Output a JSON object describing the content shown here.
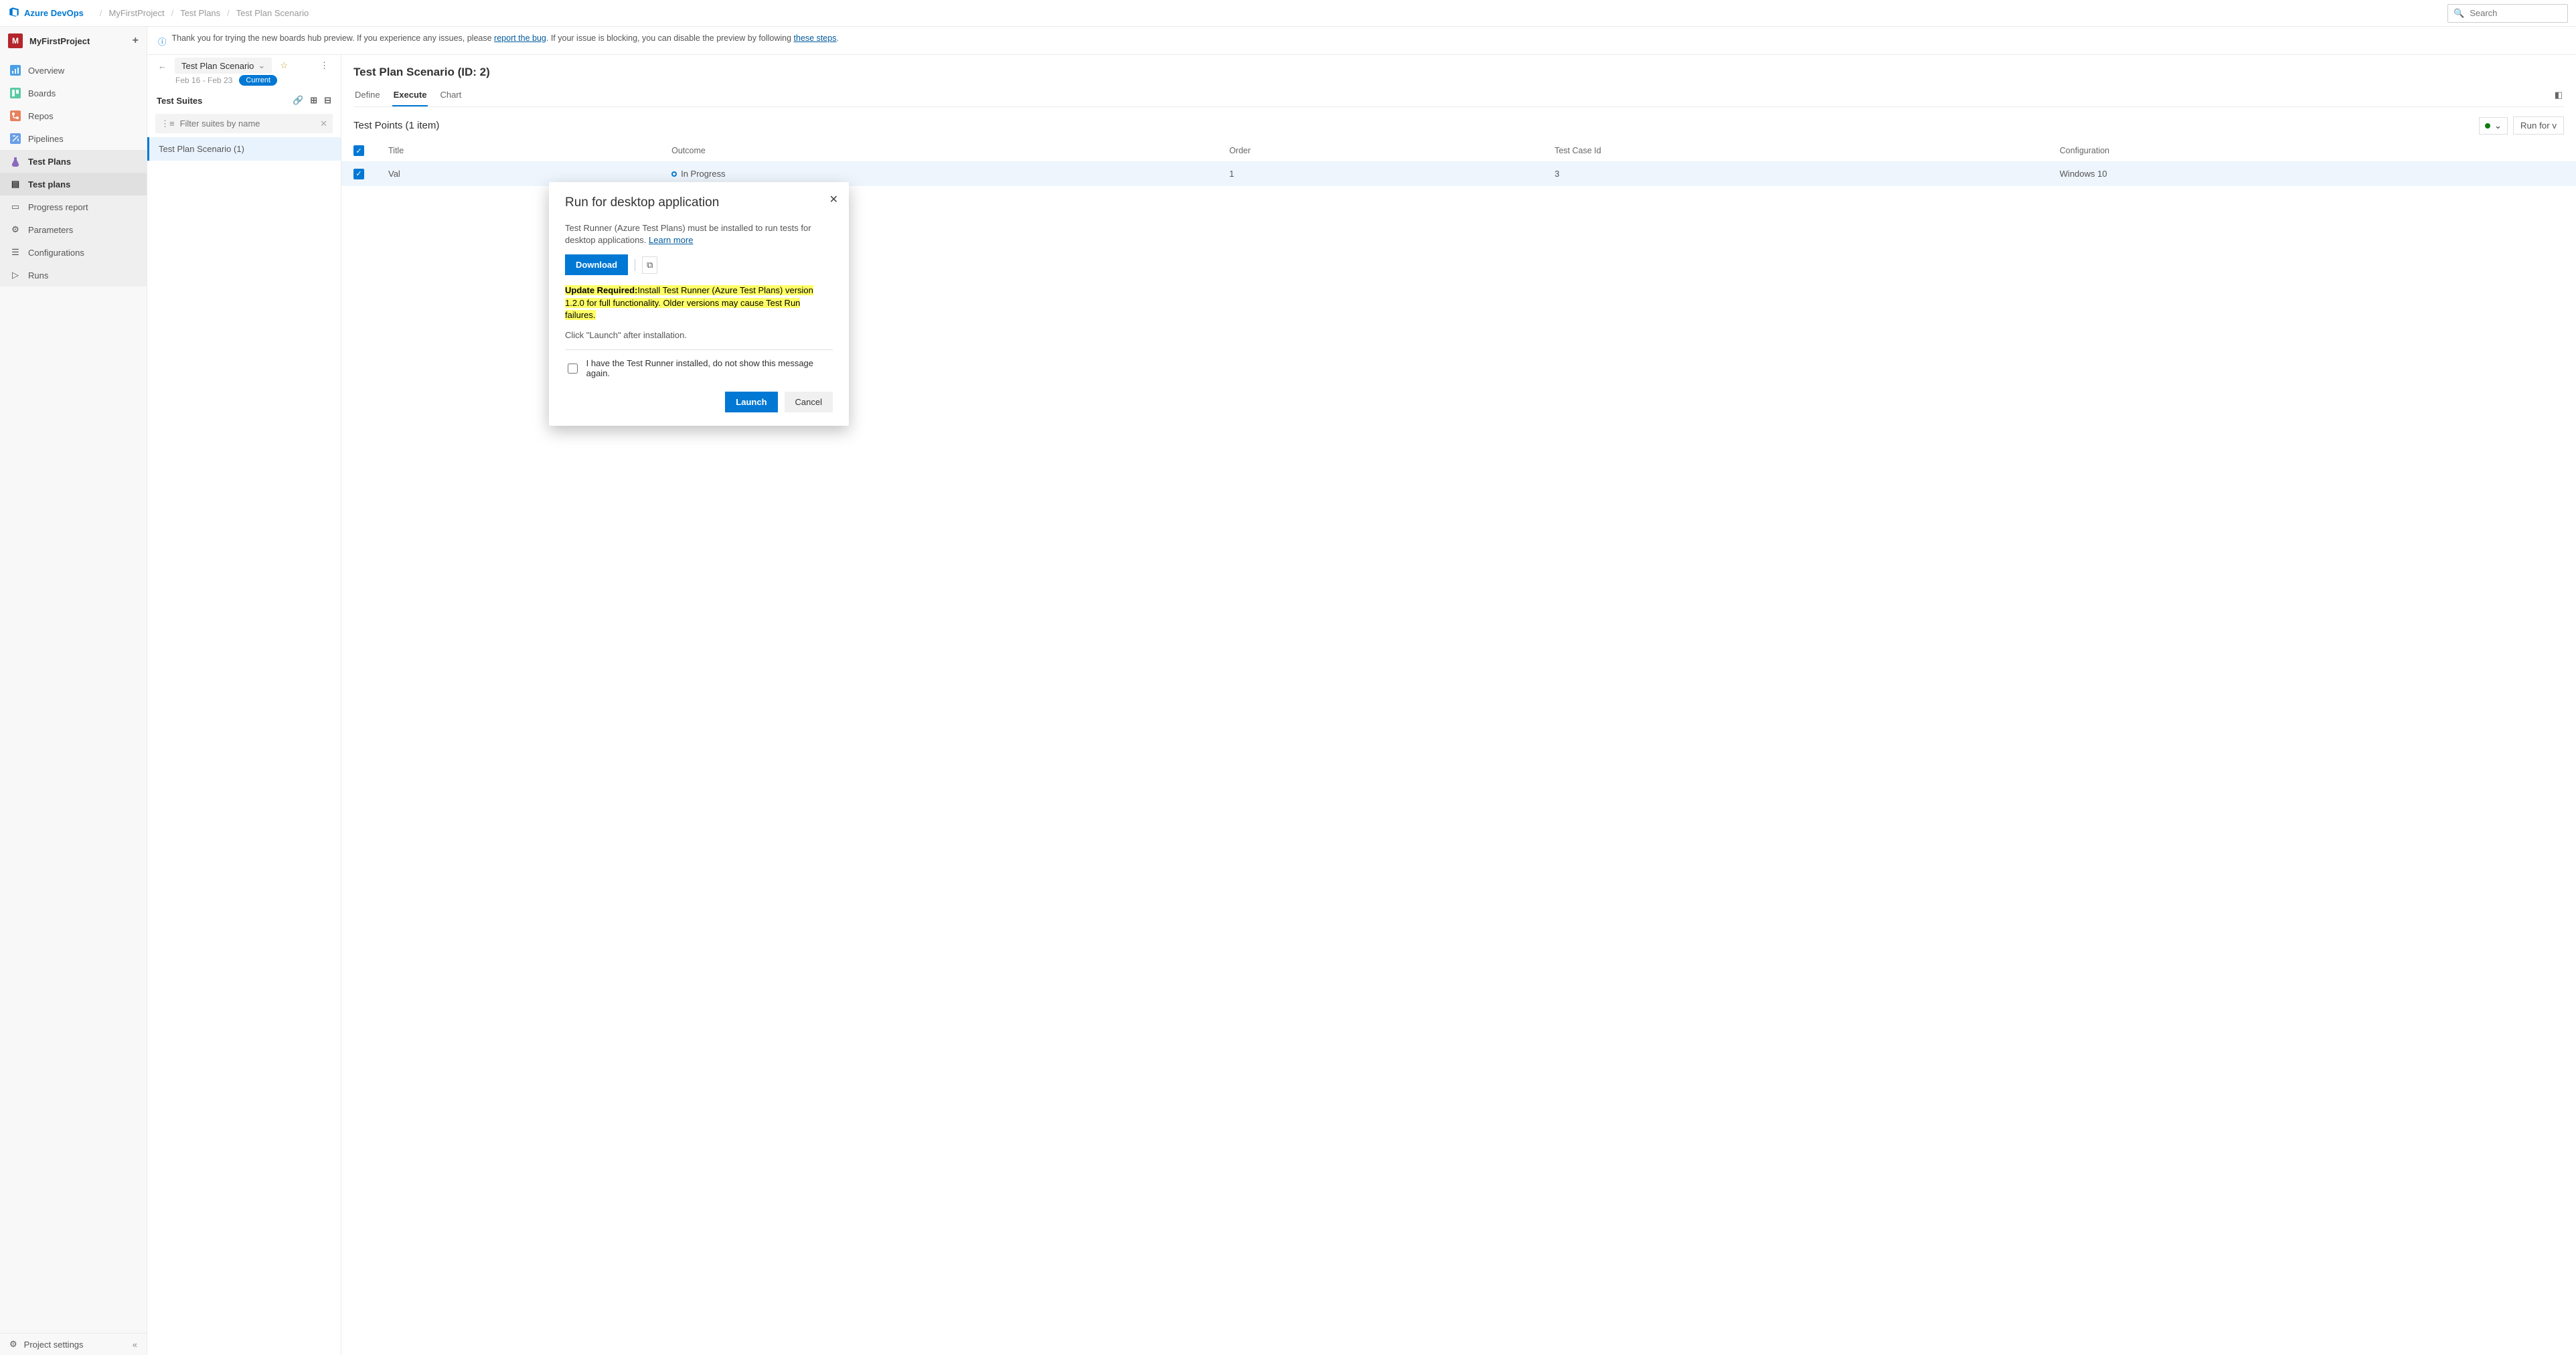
{
  "brand": "Azure DevOps",
  "breadcrumbs": [
    "MyFirstProject",
    "Test Plans",
    "Test Plan Scenario"
  ],
  "search_placeholder": "Search",
  "project": {
    "badge": "M",
    "name": "MyFirstProject"
  },
  "sidebar": {
    "items": [
      {
        "label": "Overview"
      },
      {
        "label": "Boards"
      },
      {
        "label": "Repos"
      },
      {
        "label": "Pipelines"
      },
      {
        "label": "Test Plans"
      }
    ],
    "sub_items": [
      {
        "label": "Test plans"
      },
      {
        "label": "Progress report"
      },
      {
        "label": "Parameters"
      },
      {
        "label": "Configurations"
      },
      {
        "label": "Runs"
      }
    ],
    "settings_label": "Project settings"
  },
  "banner": {
    "prefix": "Thank you for trying the new boards hub preview. If you experience any issues, please ",
    "link1": "report the bug",
    "mid": ". If your issue is blocking, you can disable the preview by following ",
    "link2": "these steps",
    "suffix": "."
  },
  "plan": {
    "name": "Test Plan Scenario",
    "dates": "Feb 16 - Feb 23",
    "badge": "Current",
    "suites_heading": "Test Suites",
    "filter_placeholder": "Filter suites by name",
    "suite_item": "Test Plan Scenario (1)"
  },
  "main": {
    "title": "Test Plan Scenario (ID: 2)",
    "tabs": [
      "Define",
      "Execute",
      "Chart"
    ],
    "points_label": "Test Points (1 item)",
    "run_button": "Run for v",
    "columns": [
      "Title",
      "Outcome",
      "Order",
      "Test Case Id",
      "Configuration"
    ],
    "row": {
      "title": "Val",
      "outcome": "In Progress",
      "order": "1",
      "test_case_id": "3",
      "configuration": "Windows 10"
    }
  },
  "modal": {
    "title": "Run for desktop application",
    "body": "Test Runner (Azure Test Plans) must be installed to run tests for desktop applications. ",
    "learn_more": "Learn more",
    "download": "Download",
    "update_label": "Update Required:",
    "update_text": "Install Test Runner (Azure Test Plans) version 1.2.0 for full functionality. Older versions may cause Test Run failures.",
    "after_install": "Click \"Launch\" after installation.",
    "checkbox_label": "I have the Test Runner installed, do not show this message again.",
    "launch": "Launch",
    "cancel": "Cancel"
  }
}
